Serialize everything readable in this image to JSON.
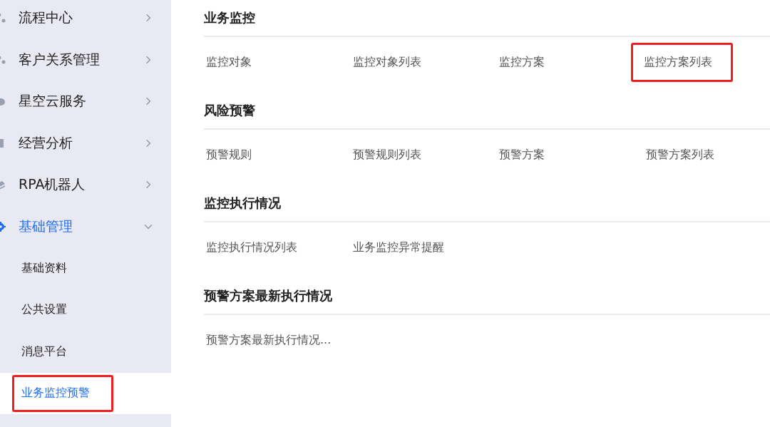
{
  "sidebar": {
    "items": [
      {
        "label": "流程中心",
        "expanded": false,
        "selected": false
      },
      {
        "label": "客户关系管理",
        "expanded": false,
        "selected": false
      },
      {
        "label": "星空云服务",
        "expanded": false,
        "selected": false
      },
      {
        "label": "经营分析",
        "expanded": false,
        "selected": false
      },
      {
        "label": "RPA机器人",
        "expanded": false,
        "selected": false
      },
      {
        "label": "基础管理",
        "expanded": true,
        "selected": true,
        "children": [
          {
            "label": "基础资料",
            "selected": false,
            "highlighted": false
          },
          {
            "label": "公共设置",
            "selected": false,
            "highlighted": false
          },
          {
            "label": "消息平台",
            "selected": false,
            "highlighted": false
          },
          {
            "label": "业务监控预警",
            "selected": true,
            "highlighted": true
          }
        ]
      }
    ]
  },
  "sections": [
    {
      "title": "业务监控",
      "links": [
        {
          "label": "监控对象",
          "highlighted": false
        },
        {
          "label": "监控对象列表",
          "highlighted": false
        },
        {
          "label": "监控方案",
          "highlighted": false
        },
        {
          "label": "监控方案列表",
          "highlighted": true
        }
      ]
    },
    {
      "title": "风险预警",
      "links": [
        {
          "label": "预警规则",
          "highlighted": false
        },
        {
          "label": "预警规则列表",
          "highlighted": false
        },
        {
          "label": "预警方案",
          "highlighted": false
        },
        {
          "label": "预警方案列表",
          "highlighted": false
        }
      ]
    },
    {
      "title": "监控执行情况",
      "links": [
        {
          "label": "监控执行情况列表",
          "highlighted": false
        },
        {
          "label": "业务监控异常提醒",
          "highlighted": false
        }
      ]
    },
    {
      "title": "预警方案最新执行情况",
      "links": [
        {
          "label": "预警方案最新执行情况...",
          "highlighted": false
        }
      ]
    }
  ]
}
